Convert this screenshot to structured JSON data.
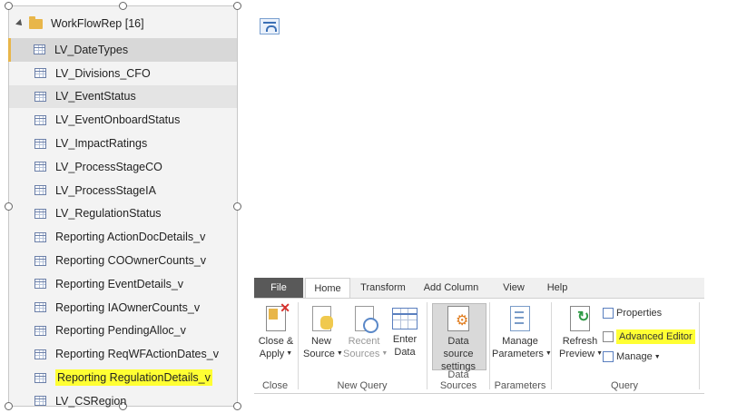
{
  "navigator": {
    "folder_label": "WorkFlowRep [16]",
    "items": [
      {
        "label": "LV_DateTypes"
      },
      {
        "label": "LV_Divisions_CFO"
      },
      {
        "label": "LV_EventStatus"
      },
      {
        "label": "LV_EventOnboardStatus"
      },
      {
        "label": "LV_ImpactRatings"
      },
      {
        "label": "LV_ProcessStageCO"
      },
      {
        "label": "LV_ProcessStageIA"
      },
      {
        "label": "LV_RegulationStatus"
      },
      {
        "label": "Reporting ActionDocDetails_v"
      },
      {
        "label": "Reporting COOwnerCounts_v"
      },
      {
        "label": "Reporting EventDetails_v"
      },
      {
        "label": "Reporting IAOwnerCounts_v"
      },
      {
        "label": "Reporting PendingAlloc_v"
      },
      {
        "label": "Reporting ReqWFActionDates_v"
      },
      {
        "label": "Reporting RegulationDetails_v"
      },
      {
        "label": "LV_CSRegion"
      }
    ]
  },
  "ribbon": {
    "tabs": [
      "File",
      "Home",
      "Transform",
      "Add Column",
      "View",
      "Help"
    ],
    "groups": {
      "close": {
        "label": "Close",
        "close_apply_l1": "Close &",
        "close_apply_l2": "Apply"
      },
      "new_query": {
        "label": "New Query",
        "new_source_l1": "New",
        "new_source_l2": "Source",
        "recent_sources_l1": "Recent",
        "recent_sources_l2": "Sources",
        "enter_data_l1": "Enter",
        "enter_data_l2": "Data"
      },
      "data_sources": {
        "label": "Data Sources",
        "ds_settings_l1": "Data source",
        "ds_settings_l2": "settings"
      },
      "parameters": {
        "label": "Parameters",
        "manage_params_l1": "Manage",
        "manage_params_l2": "Parameters"
      },
      "query": {
        "label": "Query",
        "refresh_l1": "Refresh",
        "refresh_l2": "Preview",
        "properties": "Properties",
        "advanced_editor": "Advanced Editor",
        "manage": "Manage"
      }
    }
  },
  "colors": {
    "highlight": "#ffff33",
    "folder": "#e8b64a",
    "file_tab": "#595959"
  }
}
